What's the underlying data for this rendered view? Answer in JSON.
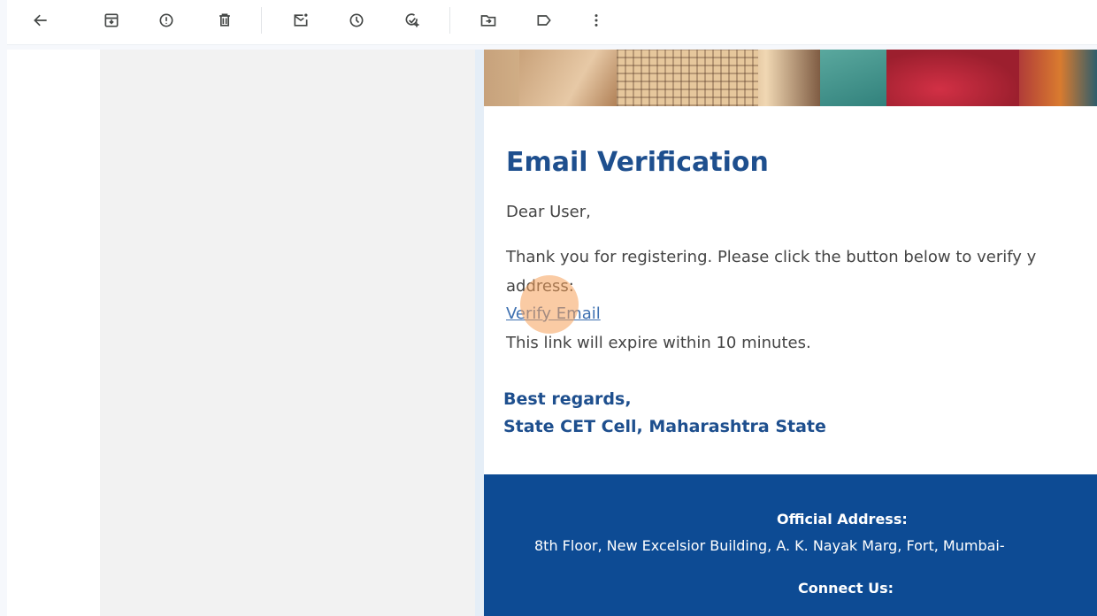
{
  "toolbar": {
    "buttons": [
      {
        "name": "back",
        "icon": "arrow-left-icon"
      },
      {
        "name": "archive",
        "icon": "archive-icon"
      },
      {
        "name": "report-spam",
        "icon": "report-icon"
      },
      {
        "name": "delete",
        "icon": "trash-icon"
      },
      {
        "name": "mark-unread",
        "icon": "mail-unread-icon"
      },
      {
        "name": "snooze",
        "icon": "clock-icon"
      },
      {
        "name": "add-task",
        "icon": "add-task-icon"
      },
      {
        "name": "move-to",
        "icon": "folder-move-icon"
      },
      {
        "name": "label",
        "icon": "label-icon"
      },
      {
        "name": "more",
        "icon": "more-vertical-icon"
      }
    ]
  },
  "email": {
    "heading": "Email Verification",
    "greeting": "Dear User,",
    "para_line1": "Thank you for registering. Please click the button below to verify y",
    "para_line2": "address:",
    "verify_link": "Verify Email",
    "expire_note": "This link will expire within 10 minutes.",
    "regards": "Best regards,",
    "org": "State CET Cell, Maharashtra State",
    "footer": {
      "address_label": "Official Address:",
      "address_text": "8th Floor, New Excelsior Building, A. K. Nayak Marg, Fort, Mumbai-",
      "connect_label": "Connect Us:"
    }
  },
  "colors": {
    "heading": "#1e4f8e",
    "link": "#3c6fb0",
    "footer_bg": "#0d4b94",
    "body_text": "#444444"
  }
}
